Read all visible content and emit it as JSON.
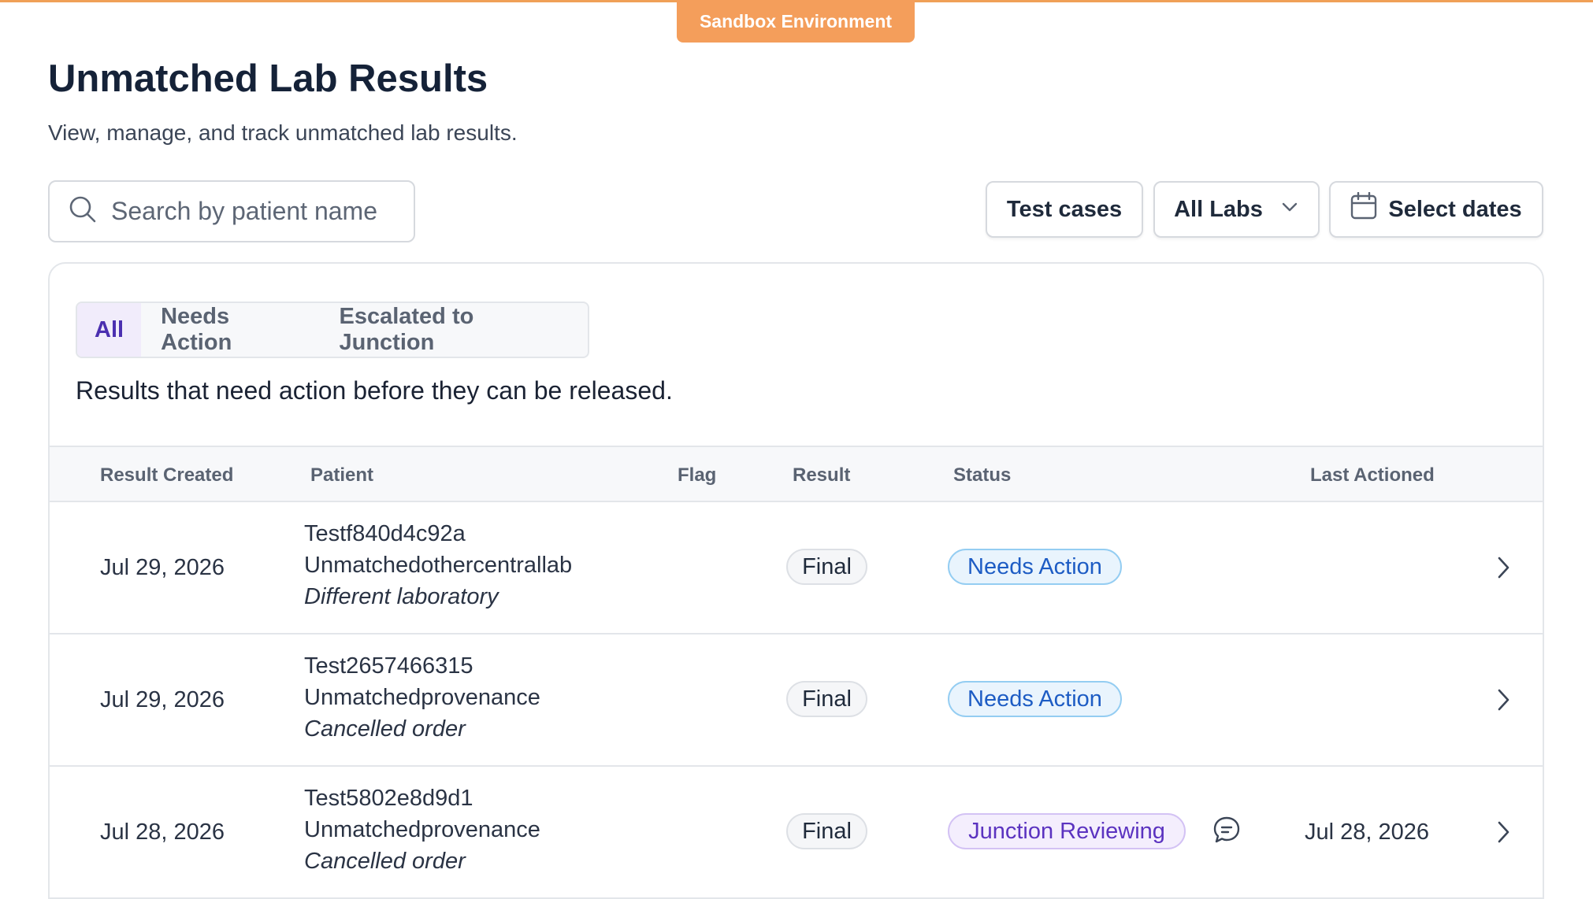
{
  "banner": {
    "label": "Sandbox Environment"
  },
  "header": {
    "title": "Unmatched Lab Results",
    "subtitle": "View, manage, and track unmatched lab results."
  },
  "search": {
    "placeholder": "Search by patient name",
    "value": ""
  },
  "filters": {
    "test_cases": "Test cases",
    "labs": "All Labs",
    "dates": "Select dates"
  },
  "tabs": [
    {
      "label": "All",
      "active": true
    },
    {
      "label": "Needs Action",
      "active": false
    },
    {
      "label": "Escalated to Junction",
      "active": false
    }
  ],
  "description": "Results that need action before they can be released.",
  "table": {
    "columns": {
      "result_created": "Result Created",
      "patient": "Patient",
      "flag": "Flag",
      "result": "Result",
      "status": "Status",
      "last_actioned": "Last Actioned"
    },
    "rows": [
      {
        "result_created": "Jul 29, 2026",
        "patient_name": "Testf840d4c92a",
        "patient_surname": "Unmatchedothercentrallab",
        "patient_note": "Different laboratory",
        "result": "Final",
        "status": "Needs Action",
        "last_actioned": ""
      },
      {
        "result_created": "Jul 29, 2026",
        "patient_name": "Test2657466315",
        "patient_surname": "Unmatchedprovenance",
        "patient_note": "Cancelled order",
        "result": "Final",
        "status": "Needs Action",
        "last_actioned": ""
      },
      {
        "result_created": "Jul 28, 2026",
        "patient_name": "Test5802e8d9d1",
        "patient_surname": "Unmatchedprovenance",
        "patient_note": "Cancelled order",
        "result": "Final",
        "status": "Junction Reviewing",
        "last_actioned": "Jul 28, 2026"
      }
    ]
  },
  "colors": {
    "banner": "#f49e5b",
    "accent_tab": "#4b2fb0",
    "needs_action": "#1d5cc4",
    "junction_reviewing": "#5b33c0"
  },
  "icons": {
    "search": "search-icon",
    "labs_dropdown": "chevron-down-icon",
    "dates": "calendar-icon",
    "row_open": "chevron-right-icon",
    "comment": "comment-icon"
  }
}
